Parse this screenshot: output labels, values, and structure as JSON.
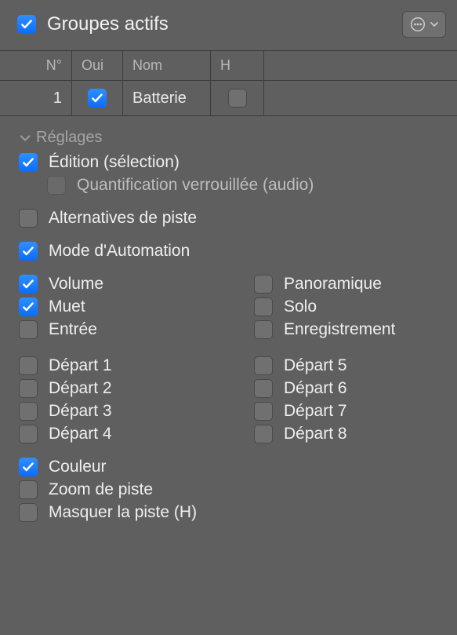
{
  "header": {
    "title": "Groupes actifs",
    "checked": true
  },
  "table": {
    "columns": [
      "N°",
      "Oui",
      "Nom",
      "H",
      ""
    ],
    "rows": [
      {
        "num": "1",
        "oui_checked": true,
        "nom": "Batterie",
        "h_checked": false
      }
    ]
  },
  "settings": {
    "label": "Réglages",
    "items": {
      "edition": {
        "label": "Édition (sélection)",
        "checked": true
      },
      "quant_lock": {
        "label": "Quantification verrouillée (audio)",
        "checked": false
      },
      "alt_piste": {
        "label": "Alternatives de piste",
        "checked": false
      },
      "automation": {
        "label": "Mode d'Automation",
        "checked": true
      },
      "volume": {
        "label": "Volume",
        "checked": true
      },
      "pan": {
        "label": "Panoramique",
        "checked": false
      },
      "mute": {
        "label": "Muet",
        "checked": true
      },
      "solo": {
        "label": "Solo",
        "checked": false
      },
      "input": {
        "label": "Entrée",
        "checked": false
      },
      "record": {
        "label": "Enregistrement",
        "checked": false
      },
      "send1": {
        "label": "Départ 1",
        "checked": false
      },
      "send5": {
        "label": "Départ 5",
        "checked": false
      },
      "send2": {
        "label": "Départ 2",
        "checked": false
      },
      "send6": {
        "label": "Départ 6",
        "checked": false
      },
      "send3": {
        "label": "Départ 3",
        "checked": false
      },
      "send7": {
        "label": "Départ 7",
        "checked": false
      },
      "send4": {
        "label": "Départ 4",
        "checked": false
      },
      "send8": {
        "label": "Départ 8",
        "checked": false
      },
      "color": {
        "label": "Couleur",
        "checked": true
      },
      "zoom": {
        "label": "Zoom de piste",
        "checked": false
      },
      "hide": {
        "label": "Masquer la piste (H)",
        "checked": false
      }
    }
  }
}
